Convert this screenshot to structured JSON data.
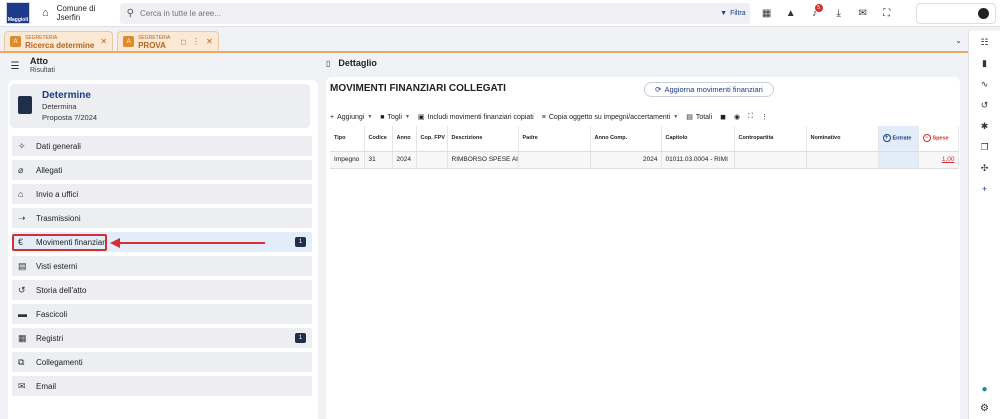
{
  "topbar": {
    "logo_text": "Maggioli",
    "ente": "Comune di Jserfin",
    "search_placeholder": "Cerca in tutte le aree...",
    "filtra": "Filtra",
    "notification_count": "5"
  },
  "tabs": [
    {
      "section": "SEGRETERIA",
      "label": "Ricerca determine"
    },
    {
      "section": "SEGRETERIA",
      "label": "PROVA"
    }
  ],
  "left": {
    "header_title": "Atto",
    "header_subtitle": "Risultati",
    "card": {
      "title": "Determine",
      "type": "Determina",
      "proposal": "Proposta 7/2024"
    },
    "nav": [
      {
        "label": "Dati generali",
        "icon": "magic-icon",
        "glyph": "✧",
        "count": ""
      },
      {
        "label": "Allegati",
        "icon": "paperclip-icon",
        "glyph": "⌀",
        "count": ""
      },
      {
        "label": "Invio a uffici",
        "icon": "building-icon",
        "glyph": "⌂",
        "count": ""
      },
      {
        "label": "Trasmissioni",
        "icon": "send-icon",
        "glyph": "➝",
        "count": ""
      },
      {
        "label": "Movimenti finanziari",
        "icon": "euro-icon",
        "glyph": "€",
        "count": "1"
      },
      {
        "label": "Visti esterni",
        "icon": "visti-icon",
        "glyph": "▤",
        "count": ""
      },
      {
        "label": "Storia dell'atto",
        "icon": "history-icon",
        "glyph": "↺",
        "count": ""
      },
      {
        "label": "Fascicoli",
        "icon": "folder-icon",
        "glyph": "▬",
        "count": ""
      },
      {
        "label": "Registri",
        "icon": "register-icon",
        "glyph": "▦",
        "count": "1"
      },
      {
        "label": "Collegamenti",
        "icon": "link-icon",
        "glyph": "⧉",
        "count": ""
      },
      {
        "label": "Email",
        "icon": "email-icon",
        "glyph": "✉",
        "count": ""
      }
    ]
  },
  "right": {
    "header": "Dettaglio",
    "title": "MOVIMENTI FINANZIARI COLLEGATI",
    "refresh_button": "Aggiorna movimenti finanziari",
    "toolbar": {
      "aggiungi": "Aggiungi",
      "togli": "Togli",
      "includi": "Includi movimenti finanziari copiati",
      "copia": "Copia oggetto su impegni/accertamenti",
      "totali": "Totali"
    },
    "columns": [
      "Tipo",
      "Codice",
      "Anno",
      "Cop. FPV",
      "Descrizione",
      "Padre",
      "Anno Comp.",
      "Capitolo",
      "Contropartita",
      "Nominativo",
      "Entrate",
      "Spese"
    ],
    "rows": [
      [
        "Impegno",
        "31",
        "2024",
        "",
        "RIMBORSO SPESE AI",
        "",
        "2024",
        "01011.03.0004 - RIMI",
        "",
        "",
        "",
        "1,00"
      ]
    ]
  },
  "colors": {
    "accent": "#1e3a8a",
    "highlight": "#d32f2f",
    "tab": "#fbe9d5"
  }
}
